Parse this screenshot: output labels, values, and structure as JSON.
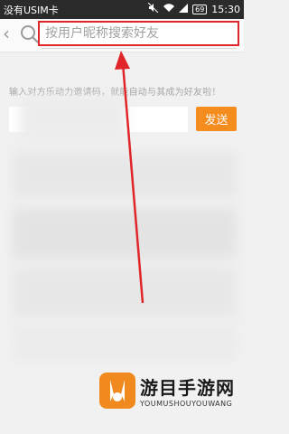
{
  "status_bar": {
    "carrier": "没有USIM卡",
    "battery": "69",
    "time": "15:30"
  },
  "search": {
    "placeholder": "按用户昵称搜索好友"
  },
  "invite": {
    "hint": "输入对方乐动力邀请码，就能自动与其成为好友啦！",
    "input_placeholder": "",
    "send_label": "发送"
  },
  "watermark": {
    "title": "游目手游网",
    "subtitle": "YOUMUSHOUYOUWANG"
  },
  "colors": {
    "highlight": "#e0262a",
    "send_button": "#f58c1e",
    "status_bar": "#2b2b2b"
  }
}
